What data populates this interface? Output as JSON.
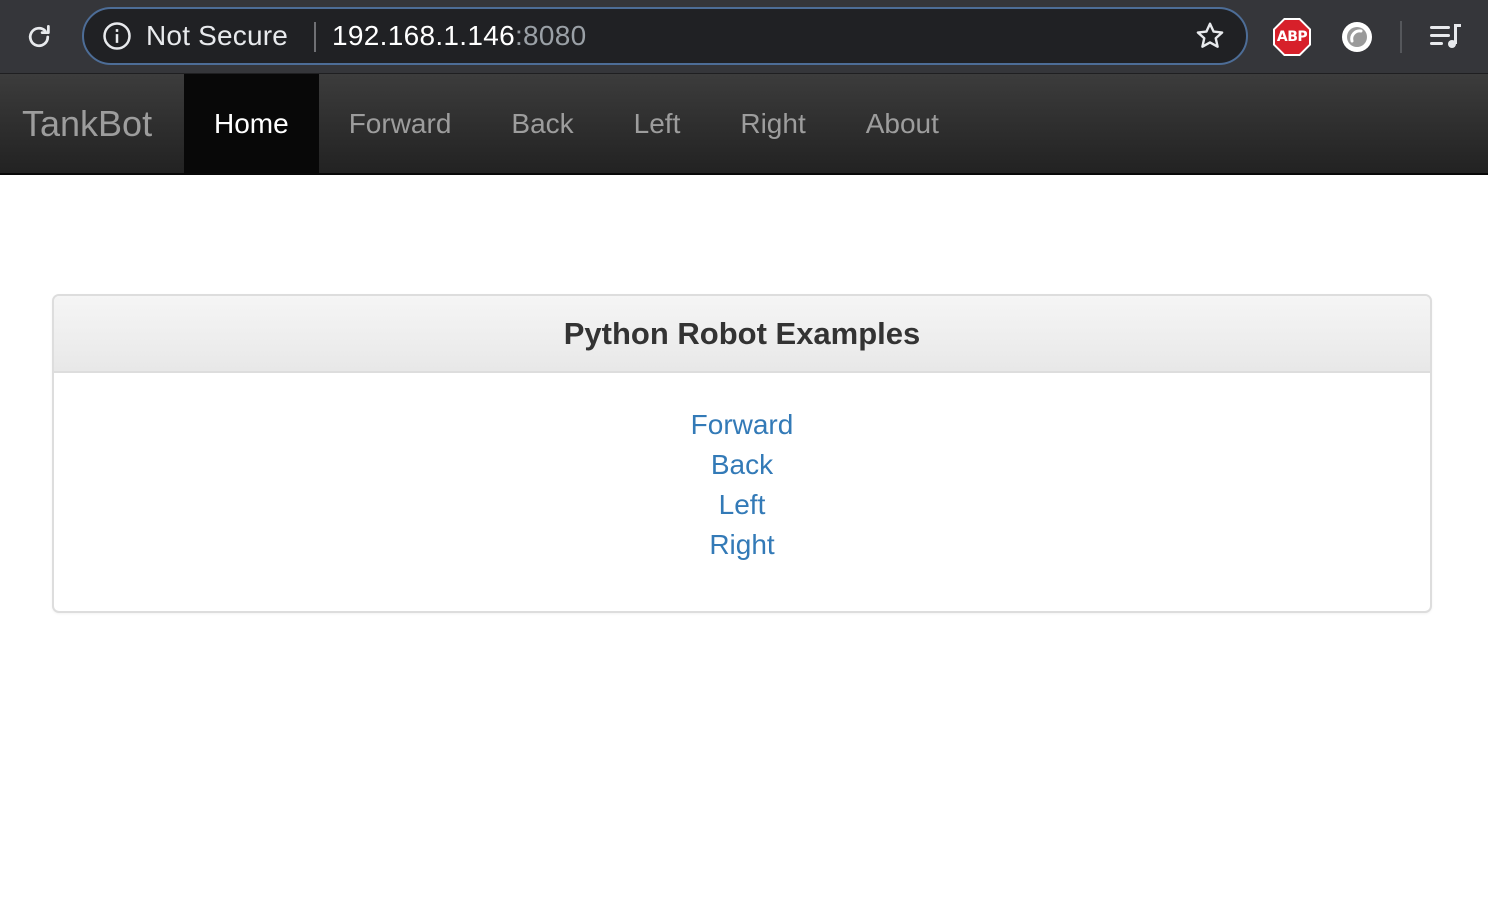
{
  "browser": {
    "security_label": "Not Secure",
    "url_host": "192.168.1.146",
    "url_port": ":8080",
    "extensions": {
      "abp_label": "ABP"
    },
    "colors": {
      "toolbar": "#35363a",
      "omnibox": "#202124",
      "omnibox_border": "#4d6d97",
      "abp_red": "#d7202a"
    }
  },
  "navbar": {
    "brand": "TankBot",
    "items": [
      {
        "label": "Home",
        "active": true
      },
      {
        "label": "Forward",
        "active": false
      },
      {
        "label": "Back",
        "active": false
      },
      {
        "label": "Left",
        "active": false
      },
      {
        "label": "Right",
        "active": false
      },
      {
        "label": "About",
        "active": false
      }
    ]
  },
  "panel": {
    "title": "Python Robot Examples",
    "links": [
      "Forward",
      "Back",
      "Left",
      "Right"
    ],
    "link_color": "#337ab7"
  }
}
